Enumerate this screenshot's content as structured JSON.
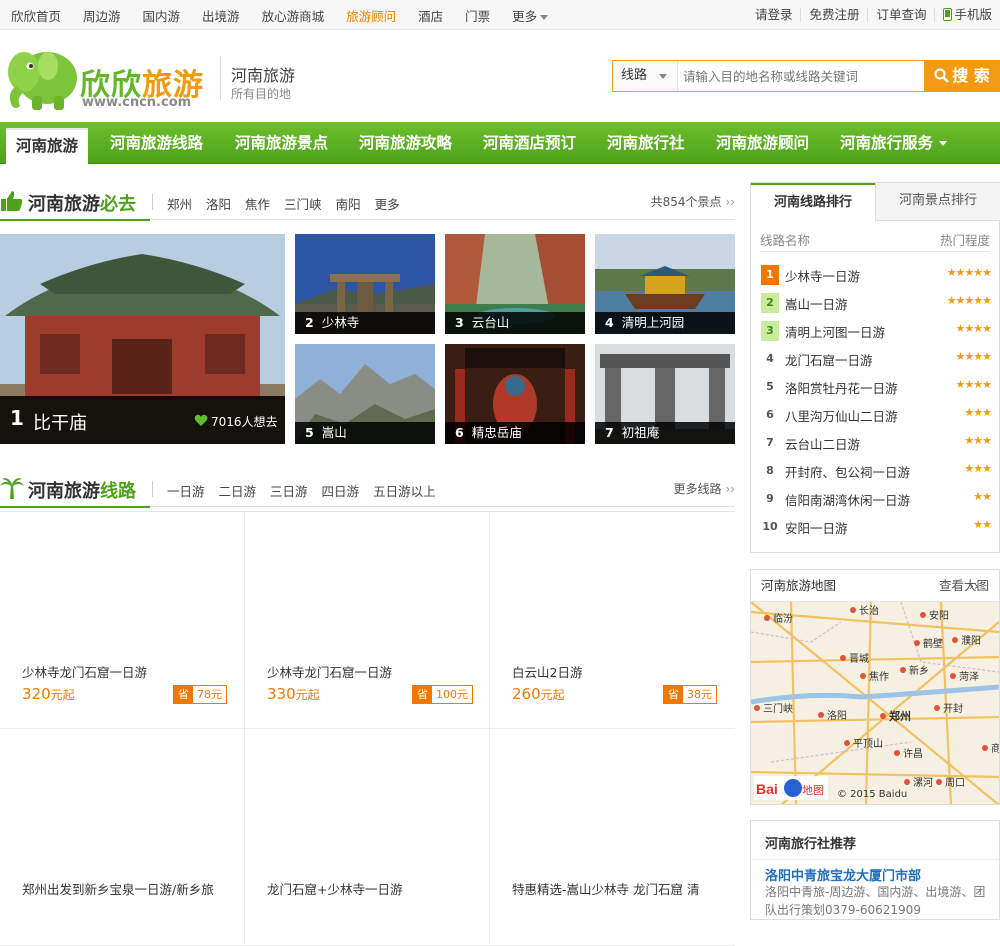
{
  "topbar": {
    "left": [
      "欣欣首页",
      "周边游",
      "国内游",
      "出境游",
      "放心游商城",
      "旅游顾问",
      "酒店",
      "门票",
      "更多"
    ],
    "active": "旅游顾问",
    "right": [
      "请登录",
      "免费注册",
      "订单查询",
      "手机版"
    ]
  },
  "header": {
    "brand_a": "欣欣",
    "brand_b": "旅游",
    "url": "www.cncn.com",
    "city": "河南旅游",
    "city_sub": "所有目的地",
    "search_type": "线路",
    "search_placeholder": "请输入目的地名称或线路关键词",
    "search_button": "搜 索"
  },
  "nav": [
    "河南旅游",
    "河南旅游线路",
    "河南旅游景点",
    "河南旅游攻略",
    "河南酒店预订",
    "河南旅行社",
    "河南旅游顾问",
    "河南旅行服务"
  ],
  "must": {
    "title_a": "河南旅游",
    "title_b": "必去",
    "tabs": [
      "郑州",
      "洛阳",
      "焦作",
      "三门峡",
      "南阳",
      "更多"
    ],
    "count": "共854个景点"
  },
  "spots": [
    {
      "rank": "1",
      "name": "比干庙",
      "likes": "7016人想去"
    },
    {
      "rank": "2",
      "name": "少林寺"
    },
    {
      "rank": "3",
      "name": "云台山"
    },
    {
      "rank": "4",
      "name": "清明上河园"
    },
    {
      "rank": "5",
      "name": "嵩山"
    },
    {
      "rank": "6",
      "name": "精忠岳庙"
    },
    {
      "rank": "7",
      "name": "初祖庵"
    }
  ],
  "routes_section": {
    "title_a": "河南旅游",
    "title_b": "线路",
    "tabs": [
      "一日游",
      "二日游",
      "三日游",
      "四日游",
      "五日游以上"
    ],
    "more": "更多线路"
  },
  "routes": [
    {
      "name": "少林寺龙门石窟一日游",
      "price": "320",
      "unit": "元起",
      "save_label": "省",
      "save": "78元"
    },
    {
      "name": "少林寺龙门石窟一日游",
      "price": "330",
      "unit": "元起",
      "save_label": "省",
      "save": "100元"
    },
    {
      "name": "白云山2日游",
      "price": "260",
      "unit": "元起",
      "save_label": "省",
      "save": "38元"
    },
    {
      "name": "郑州出发到新乡宝泉一日游/新乡旅",
      "price": "",
      "unit": "",
      "save_label": "省",
      "save": ""
    },
    {
      "name": "龙门石窟+少林寺一日游",
      "price": "",
      "unit": "",
      "save_label": "省",
      "save": ""
    },
    {
      "name": "特惠精选-嵩山少林寺 龙门石窟 清",
      "price": "",
      "unit": "",
      "save_label": "省",
      "save": ""
    }
  ],
  "ranking": {
    "tab_active": "河南线路排行",
    "tab_other": "河南景点排行",
    "col_name": "线路名称",
    "col_hot": "热门程度",
    "items": [
      {
        "n": "1",
        "name": "少林寺一日游",
        "stars": 5
      },
      {
        "n": "2",
        "name": "嵩山一日游",
        "stars": 5
      },
      {
        "n": "3",
        "name": "清明上河图一日游",
        "stars": 4
      },
      {
        "n": "4",
        "name": "龙门石窟一日游",
        "stars": 4
      },
      {
        "n": "5",
        "name": "洛阳赏牡丹花一日游",
        "stars": 4
      },
      {
        "n": "6",
        "name": "八里沟万仙山二日游",
        "stars": 3
      },
      {
        "n": "7",
        "name": "云台山二日游",
        "stars": 3
      },
      {
        "n": "8",
        "name": "开封府、包公祠一日游",
        "stars": 3
      },
      {
        "n": "9",
        "name": "信阳南湖湾休闲一日游",
        "stars": 2
      },
      {
        "n": "10",
        "name": "安阳一日游",
        "stars": 2
      }
    ]
  },
  "map": {
    "title": "河南旅游地图",
    "more": "查看大图",
    "cities": [
      "临汾",
      "长治",
      "安阳",
      "鹤壁",
      "濮阳",
      "晋城",
      "新乡",
      "焦作",
      "菏泽",
      "三门峡",
      "洛阳",
      "郑州",
      "开封",
      "许昌",
      "平顶山",
      "漯河",
      "周口",
      "商丘"
    ],
    "copyright": "© 2015 Baidu",
    "logo_a": "Bai",
    "logo_b": "地图"
  },
  "agency": {
    "title": "河南旅行社推荐",
    "name": "洛阳中青旅宝龙大厦门市部",
    "desc": "洛阳中青旅-周边游、国内游、出境游、团队出行策划0379-60621909"
  },
  "colors": {
    "green": "#4da21a",
    "orange": "#f39a12",
    "price": "#f07800",
    "link": "#1e6fc0"
  }
}
